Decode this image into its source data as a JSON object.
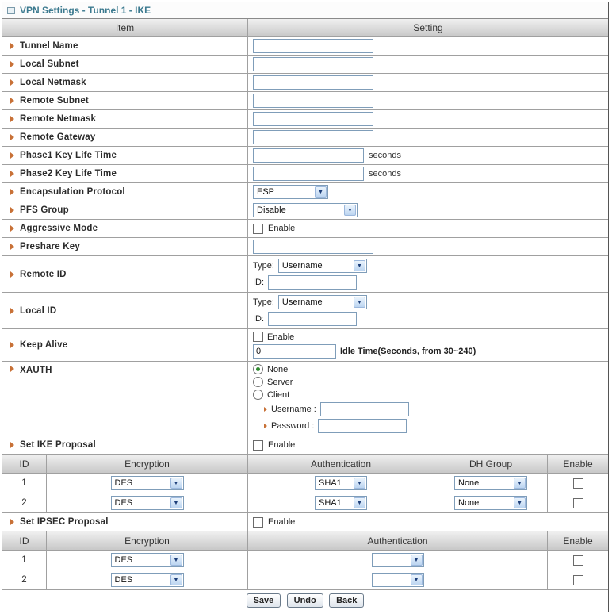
{
  "window_title": "VPN Settings - Tunnel 1 - IKE",
  "table_header": {
    "item": "Item",
    "setting": "Setting"
  },
  "fields": {
    "tunnel_name": {
      "label": "Tunnel Name",
      "value": ""
    },
    "local_subnet": {
      "label": "Local Subnet",
      "value": ""
    },
    "local_netmask": {
      "label": "Local Netmask",
      "value": ""
    },
    "remote_subnet": {
      "label": "Remote Subnet",
      "value": ""
    },
    "remote_netmask": {
      "label": "Remote Netmask",
      "value": ""
    },
    "remote_gateway": {
      "label": "Remote Gateway",
      "value": ""
    },
    "phase1_key_life_time": {
      "label": "Phase1 Key Life Time",
      "value": "",
      "suffix": "seconds"
    },
    "phase2_key_life_time": {
      "label": "Phase2 Key Life Time",
      "value": "",
      "suffix": "seconds"
    },
    "encapsulation_protocol": {
      "label": "Encapsulation Protocol",
      "selected": "ESP"
    },
    "pfs_group": {
      "label": "PFS Group",
      "selected": "Disable"
    },
    "aggressive_mode": {
      "label": "Aggressive Mode",
      "checkbox_label": "Enable",
      "checked": false
    },
    "preshare_key": {
      "label": "Preshare Key",
      "value": ""
    },
    "remote_id": {
      "label": "Remote ID",
      "type_label": "Type:",
      "type_selected": "Username",
      "id_label": "ID:",
      "id_value": ""
    },
    "local_id": {
      "label": "Local ID",
      "type_label": "Type:",
      "type_selected": "Username",
      "id_label": "ID:",
      "id_value": ""
    },
    "keep_alive": {
      "label": "Keep Alive",
      "checkbox_label": "Enable",
      "checked": false,
      "idle_value": "0",
      "idle_suffix": "Idle Time(Seconds, from 30~240)"
    },
    "xauth": {
      "label": "XAUTH",
      "option_none": "None",
      "option_server": "Server",
      "option_client": "Client",
      "none_checked": true,
      "server_checked": false,
      "client_checked": false,
      "username_label": "Username :",
      "username_value": "",
      "password_label": "Password :",
      "password_value": ""
    },
    "set_ike_proposal": {
      "label": "Set IKE Proposal",
      "checkbox_label": "Enable",
      "checked": false
    },
    "set_ipsec_proposal": {
      "label": "Set IPSEC Proposal",
      "checkbox_label": "Enable",
      "checked": false
    }
  },
  "ike_proposal_table": {
    "headers": {
      "id": "ID",
      "encryption": "Encryption",
      "authentication": "Authentication",
      "dh_group": "DH Group",
      "enable": "Enable"
    },
    "rows": [
      {
        "id": "1",
        "encryption": "DES",
        "authentication": "SHA1",
        "dh_group": "None",
        "enabled": false
      },
      {
        "id": "2",
        "encryption": "DES",
        "authentication": "SHA1",
        "dh_group": "None",
        "enabled": false
      }
    ]
  },
  "ipsec_proposal_table": {
    "headers": {
      "id": "ID",
      "encryption": "Encryption",
      "authentication": "Authentication",
      "enable": "Enable"
    },
    "rows": [
      {
        "id": "1",
        "encryption": "DES",
        "authentication": "",
        "enabled": false
      },
      {
        "id": "2",
        "encryption": "DES",
        "authentication": "",
        "enabled": false
      }
    ]
  },
  "buttons": {
    "save": "Save",
    "undo": "Undo",
    "back": "Back"
  },
  "colors": {
    "title_text": "#3c7a8f",
    "arrow_bullet": "#c87137",
    "header_bg_top": "#f0f0f0",
    "header_bg_bottom": "#c8c8c8",
    "border": "#a0a0a0",
    "input_border": "#7f9db9",
    "radio_dot": "#2d8a2d"
  }
}
